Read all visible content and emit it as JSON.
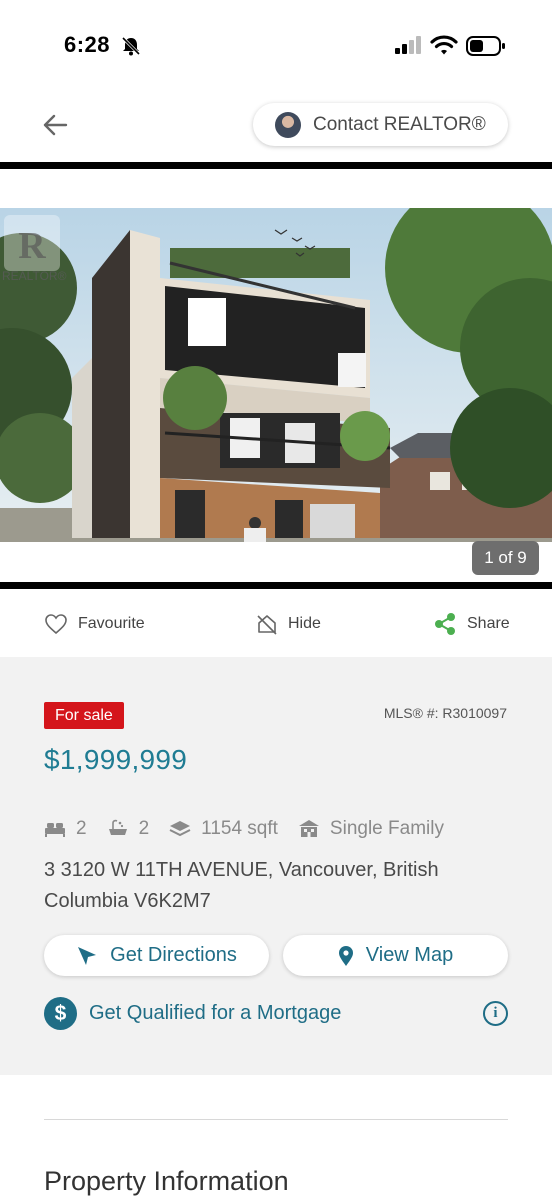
{
  "status_bar": {
    "time": "6:28",
    "icons": [
      "bell-slash-icon",
      "signal-icon",
      "wifi-icon",
      "battery-icon"
    ]
  },
  "header": {
    "back_icon": "arrow-left-icon",
    "contact_label": "Contact REALTOR®"
  },
  "gallery": {
    "watermark_text": "REALTOR®",
    "counter": "1 of 9"
  },
  "actions": {
    "favourite": "Favourite",
    "hide": "Hide",
    "share": "Share"
  },
  "listing": {
    "status_badge": "For sale",
    "mls": "MLS® #: R3010097",
    "price": "$1,999,999",
    "bedrooms": "2",
    "bathrooms": "2",
    "area": "1154 sqft",
    "building_type": "Single Family",
    "address": "3 3120 W 11TH AVENUE, Vancouver, British Columbia V6K2M7"
  },
  "buttons": {
    "directions": "Get Directions",
    "view_map": "View Map",
    "mortgage": "Get Qualified for a Mortgage",
    "mortgage_icon_glyph": "$",
    "info_glyph": "i"
  },
  "section": {
    "title": "Property Information"
  },
  "colors": {
    "accent": "#1f6d86",
    "price": "#1f7c93",
    "badge": "#d4151b",
    "share_green": "#4caf50"
  }
}
